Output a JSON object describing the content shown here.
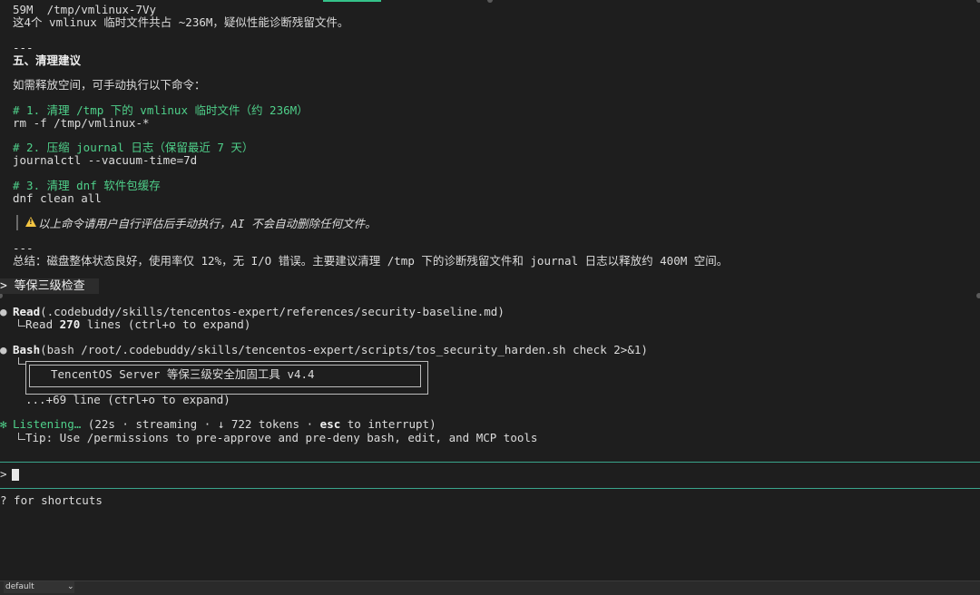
{
  "window": {
    "profile_selector": "default",
    "profile_chevron": "⌄",
    "accent_color": "#35c28a"
  },
  "output": {
    "line_tmp_file": "59M  /tmp/vmlinux-7Vy",
    "line_summary_tmp": "这4个 vmlinux 临时文件共占 ~236M，疑似性能诊断残留文件。",
    "sep1": "---",
    "section5_title": "五、清理建议",
    "intro": "如需释放空间，可手动执行以下命令：",
    "cmd1_comment": "# 1. 清理 /tmp 下的 vmlinux 临时文件（约 236M）",
    "cmd1": "rm -f /tmp/vmlinux-*",
    "cmd2_comment": "# 2. 压缩 journal 日志（保留最近 7 天）",
    "cmd2": "journalctl --vacuum-time=7d",
    "cmd3_comment": "# 3. 清理 dnf 软件包缓存",
    "cmd3": "dnf clean all",
    "warning": "以上命令请用户自行评估后手动执行，AI 不会自动删除任何文件。",
    "sep2": "---",
    "conclusion": "总结：磁盘整体状态良好，使用率仅 12%，无 I/O 错误。主要建议清理 /tmp 下的诊断残留文件和 journal 日志以释放约 400M 空间。"
  },
  "user_prompt": {
    "text": "> 等保三级检查 "
  },
  "tool_read": {
    "dot": "●",
    "name": "Read",
    "args": "(.codebuddy/skills/tencentos-expert/references/security-baseline.md)",
    "result_prefix": "Read ",
    "result_count": "270",
    "result_suffix": " lines (ctrl+o to expand)"
  },
  "tool_bash": {
    "dot": "●",
    "name": "Bash",
    "args": "(bash /root/.codebuddy/skills/tencentos-expert/scripts/tos_security_harden.sh check 2>&1)",
    "box_title": "TencentOS Server 等保三级安全加固工具 v4.4",
    "more": "...+69 line (ctrl+o to expand)"
  },
  "status": {
    "dot": "✻",
    "label": "Listening…",
    "detail_prefix": " (22s · streaming · ↓ 722 tokens · ",
    "esc": "esc",
    "detail_suffix": " to interrupt)",
    "tip": "Tip: Use /permissions to pre-approve and pre-deny bash, edit, and MCP tools"
  },
  "input": {
    "caret": ">",
    "value": ""
  },
  "footer": {
    "shortcuts_hint": "? for shortcuts"
  }
}
